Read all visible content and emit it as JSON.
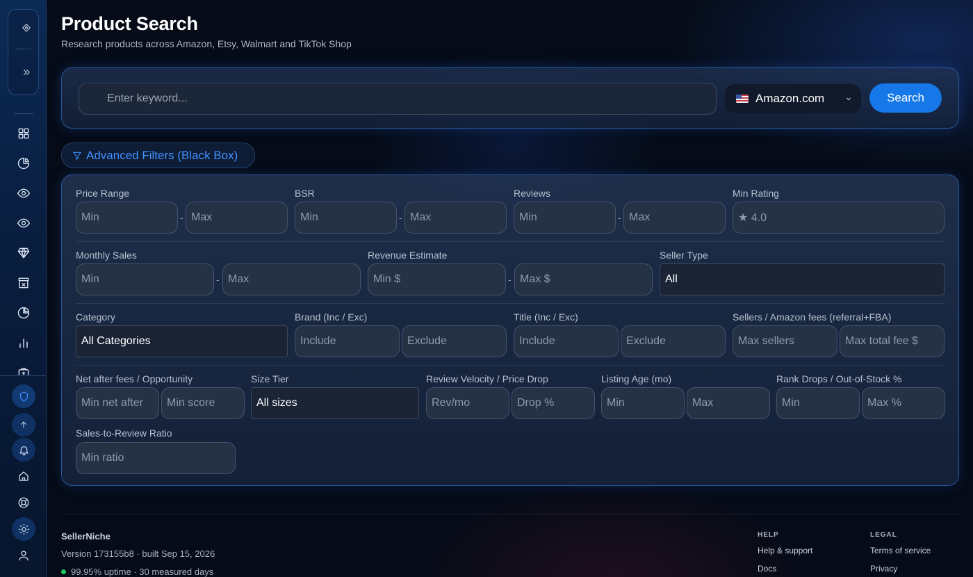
{
  "header": {
    "title": "Product Search",
    "subtitle": "Research products across Amazon, Etsy, Walmart and TikTok Shop"
  },
  "search": {
    "placeholder": "Enter keyword...",
    "marketplace": "Amazon.com",
    "button": "Search"
  },
  "advanced_toggle": "Advanced Filters (Black Box)",
  "filters": {
    "price_range": {
      "label": "Price Range",
      "min": "Min",
      "max": "Max"
    },
    "bsr": {
      "label": "BSR",
      "min": "Min",
      "max": "Max"
    },
    "reviews": {
      "label": "Reviews",
      "min": "Min",
      "max": "Max"
    },
    "min_rating": {
      "label": "Min Rating",
      "value": "★ 4.0"
    },
    "monthly_sales": {
      "label": "Monthly Sales",
      "min": "Min",
      "max": "Max"
    },
    "revenue": {
      "label": "Revenue Estimate",
      "min": "Min $",
      "max": "Max $"
    },
    "seller_type": {
      "label": "Seller Type",
      "value": "All"
    },
    "category": {
      "label": "Category",
      "value": "All Categories"
    },
    "brand": {
      "label": "Brand (Inc / Exc)",
      "include": "Include",
      "exclude": "Exclude"
    },
    "title": {
      "label": "Title (Inc / Exc)",
      "include": "Include",
      "exclude": "Exclude"
    },
    "sellers_fees": {
      "label": "Sellers / Amazon fees (referral+FBA)",
      "sellers": "Max sellers",
      "fee": "Max total fee $"
    },
    "net_opportunity": {
      "label": "Net after fees / Opportunity",
      "net": "Min net after",
      "score": "Min score"
    },
    "size_tier": {
      "label": "Size Tier",
      "value": "All sizes"
    },
    "velocity_drop": {
      "label": "Review Velocity / Price Drop",
      "velocity": "Rev/mo",
      "drop": "Drop %"
    },
    "listing_age": {
      "label": "Listing Age (mo)",
      "min": "Min",
      "max": "Max"
    },
    "rank_oos": {
      "label": "Rank Drops / Out-of-Stock %",
      "min": "Min",
      "max": "Max %"
    },
    "sales_review": {
      "label": "Sales-to-Review Ratio",
      "min": "Min ratio"
    }
  },
  "footer": {
    "brand": "SellerNiche",
    "version": "Version 173155b8 · built Sep 15, 2026",
    "uptime": "99.95% uptime · 30 measured days",
    "help": {
      "heading": "HELP",
      "links": [
        "Help & support",
        "Docs"
      ]
    },
    "legal": {
      "heading": "LEGAL",
      "links": [
        "Terms of service",
        "Privacy"
      ]
    }
  },
  "sidebar": {
    "icons": [
      "diamond-logo-icon",
      "expand-icon",
      "dashboard-grid-icon",
      "pie-chart-icon",
      "eye-icon",
      "eye-icon",
      "gem-icon",
      "store-icon",
      "analytics-pie-icon",
      "bar-chart-icon",
      "briefcase-icon",
      "shield-icon",
      "arrow-up-icon",
      "bell-icon",
      "home-icon",
      "lifebuoy-icon",
      "sun-icon",
      "user-icon"
    ]
  },
  "colors": {
    "accent": "#1577e8",
    "accent_text": "#3f93ff",
    "background": "#050b17",
    "uptime_dot": "#22c55e"
  }
}
